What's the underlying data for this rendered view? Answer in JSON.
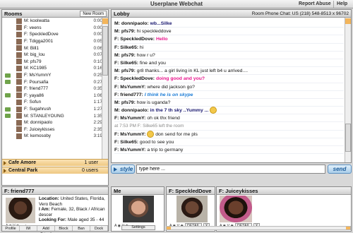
{
  "topbar": {
    "title": "Userplane Webchat",
    "report_abuse": "Report Abuse",
    "help": "Help"
  },
  "rooms": {
    "title": "Rooms",
    "new_room": "New Room",
    "users": [
      {
        "name": "M: koolwatta",
        "time": "0:00",
        "cam": false
      },
      {
        "name": "F: veens",
        "time": "0:00",
        "cam": false
      },
      {
        "name": "F: SpeckledDove",
        "time": "0:00",
        "cam": false
      },
      {
        "name": "F: Tdigga2001",
        "time": "0:05",
        "cam": false
      },
      {
        "name": "M: Bill1",
        "time": "0:06",
        "cam": false
      },
      {
        "name": "M: big_lou",
        "time": "0:07",
        "cam": false
      },
      {
        "name": "M: pfs79",
        "time": "0:10",
        "cam": false
      },
      {
        "name": "M: KC1985",
        "time": "0:16",
        "cam": false
      },
      {
        "name": "F: MsYummY",
        "time": "0:25",
        "cam": true
      },
      {
        "name": "F: Poursafia",
        "time": "0:27",
        "cam": true
      },
      {
        "name": "F: friend777",
        "time": "0:35",
        "cam": false
      },
      {
        "name": "F: yaya86",
        "time": "1:06",
        "cam": true
      },
      {
        "name": "F: Sofun",
        "time": "1:17",
        "cam": false
      },
      {
        "name": "F: Sugahrush",
        "time": "1:27",
        "cam": true
      },
      {
        "name": "M: STANLEYOUNG",
        "time": "1:35",
        "cam": true
      },
      {
        "name": "M: donnipaolo",
        "time": "2:29",
        "cam": false
      },
      {
        "name": "F: Juiceykisses",
        "time": "2:35",
        "cam": false
      },
      {
        "name": "M: kemosoby",
        "time": "3:19",
        "cam": false
      }
    ],
    "footer_room": "Cafe Amore",
    "footer_count": "1 user",
    "footer2_room": "Central Park",
    "footer2_count": "0 users"
  },
  "lobby": {
    "title": "Lobby",
    "phone": "Room Phone Chat:  US (218) 548-8513 x 96702",
    "messages": [
      {
        "who": "M: donnipaolo:",
        "text": "wb...Silke",
        "style": "navy"
      },
      {
        "who": "M: pfs79:",
        "text": "hi speckleddove",
        "style": ""
      },
      {
        "who": "F: SpeckledDove:",
        "text": "Hello",
        "style": "pink"
      },
      {
        "who": "F: Silke65:",
        "text": "hi",
        "style": ""
      },
      {
        "who": "M: pfs79:",
        "text": "how r u?",
        "style": ""
      },
      {
        "who": "F: Silke65:",
        "text": "fine and you",
        "style": ""
      },
      {
        "who": "M: pfs79:",
        "text": "gr8 thanks... a girl living in KL just left b4 u arrived....",
        "style": ""
      },
      {
        "who": "F: SpeckledDove:",
        "text": "doing good and you?",
        "style": "pink"
      },
      {
        "who": "F: MsYummY:",
        "text": "where did jackson go?",
        "style": ""
      },
      {
        "who": "F: friend777:",
        "text": "I think he is on skype",
        "style": "blue"
      },
      {
        "who": "M: pfs79:",
        "text": "how is uganda?",
        "style": ""
      },
      {
        "who": "M: donnipaolo:",
        "text": "in the 7 th sky ..Yummy ...",
        "style": "navy",
        "smiley": true
      },
      {
        "who": "F: MsYummY:",
        "text": "oh ok thx friend",
        "style": ""
      },
      {
        "who": "",
        "text": "at 7:53 PM F: Silke65 left the room",
        "style": "sys"
      },
      {
        "who": "F: MsYummY:",
        "text": "don send for me pls",
        "style": "",
        "smiley_before": true
      },
      {
        "who": "F: Silke65:",
        "text": "good to see you",
        "style": ""
      },
      {
        "who": "F: MsYummY:",
        "text": "a trip to germany",
        "style": ""
      }
    ]
  },
  "input": {
    "style_label": "style",
    "value": "type here ...",
    "send_label": "send"
  },
  "profile": {
    "title": "F: friend777",
    "location_label": "Location:",
    "location": "United States, Florida, Vero Beach",
    "iam_label": "I Am:",
    "iam": "Female, 32, Black / African descer",
    "looking_label": "Looking For:",
    "looking": "Male aged 35 - 44",
    "buttons": [
      "Profile",
      "IM",
      "Add Friend",
      "Block",
      "Ban",
      "Dock"
    ]
  },
  "cams": {
    "me_title": "Me",
    "settings": "Settings",
    "dove_title": "F: SpeckledDove",
    "juicey_title": "F: Juiceykisses",
    "detail": "DETAIL",
    "close": "X"
  }
}
